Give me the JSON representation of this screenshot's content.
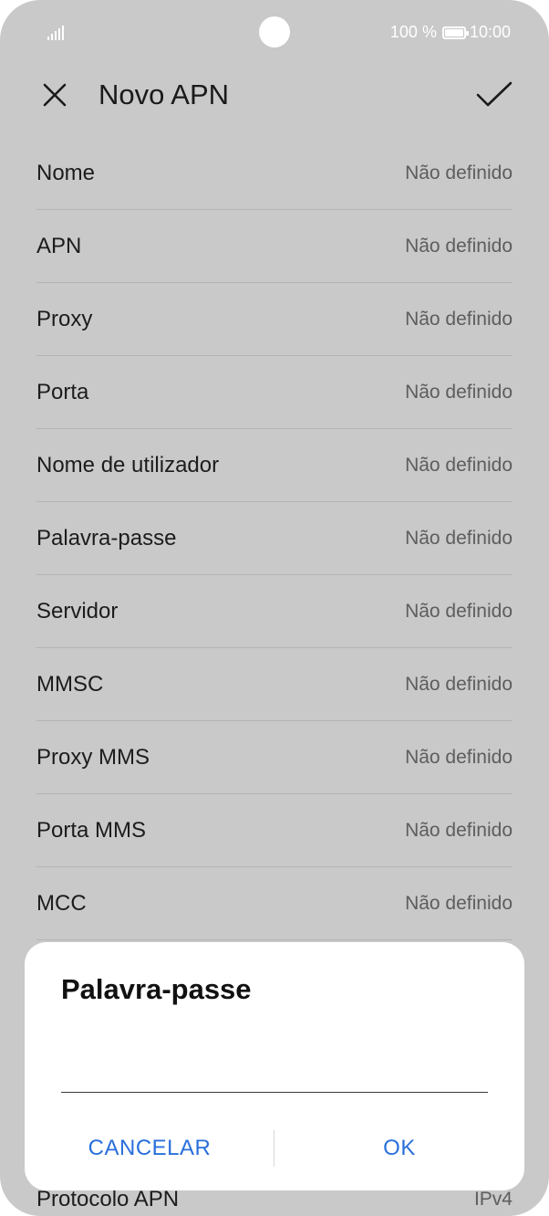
{
  "status_bar": {
    "battery_percent": "100 %",
    "time": "10:00",
    "icons": [
      "signal-icon",
      "battery-icon"
    ]
  },
  "header": {
    "title": "Novo APN",
    "close_icon": "close-icon",
    "confirm_icon": "check-icon"
  },
  "fields": [
    {
      "label": "Nome",
      "value": "Não definido"
    },
    {
      "label": "APN",
      "value": "Não definido"
    },
    {
      "label": "Proxy",
      "value": "Não definido"
    },
    {
      "label": "Porta",
      "value": "Não definido"
    },
    {
      "label": "Nome de utilizador",
      "value": "Não definido"
    },
    {
      "label": "Palavra-passe",
      "value": "Não definido"
    },
    {
      "label": "Servidor",
      "value": "Não definido"
    },
    {
      "label": "MMSC",
      "value": "Não definido"
    },
    {
      "label": "Proxy MMS",
      "value": "Não definido"
    },
    {
      "label": "Porta MMS",
      "value": "Não definido"
    },
    {
      "label": "MCC",
      "value": "Não definido"
    }
  ],
  "bottom_field": {
    "label": "Protocolo APN",
    "value": "IPv4"
  },
  "dialog": {
    "title": "Palavra-passe",
    "input_value": "",
    "cancel_label": "CANCELAR",
    "ok_label": "OK"
  },
  "colors": {
    "accent": "#2a6fdb",
    "background_dimmed": "#c9c9c9",
    "dialog_background": "#ffffff"
  }
}
